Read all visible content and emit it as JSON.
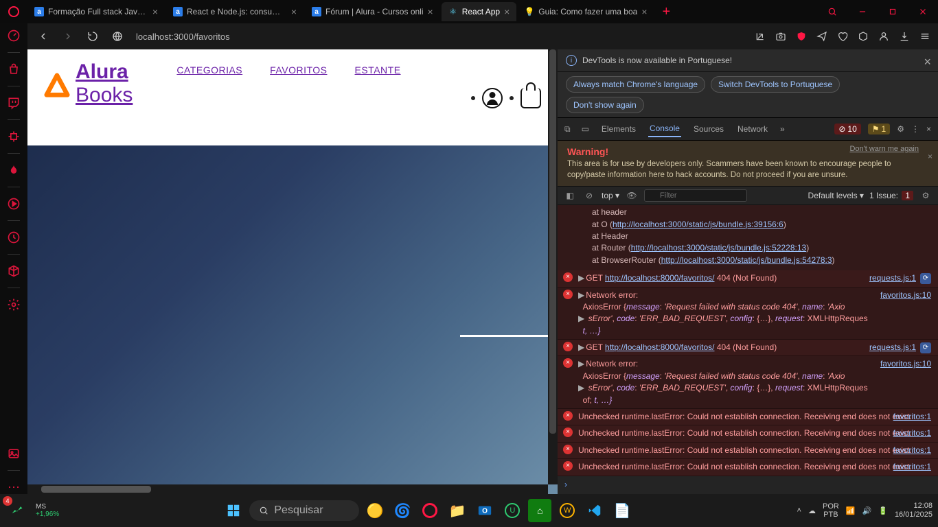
{
  "titlebar": {
    "tabs": [
      {
        "title": "Formação Full stack JavaSc",
        "icon": "a",
        "active": false
      },
      {
        "title": "React e Node.js: consumind",
        "icon": "a",
        "active": false
      },
      {
        "title": "Fórum | Alura - Cursos onli",
        "icon": "a",
        "active": false
      },
      {
        "title": "React App",
        "icon": "react",
        "active": true
      },
      {
        "title": "Guia: Como fazer uma boa",
        "icon": "bulb",
        "active": false
      }
    ]
  },
  "url": "localhost:3000/favoritos",
  "page": {
    "brand_top": "Alura",
    "brand_bottom": "Books",
    "nav": [
      "CATEGORIAS",
      "FAVORITOS",
      "ESTANTE"
    ]
  },
  "devtools": {
    "banner": "DevTools is now available in Portuguese!",
    "btns": [
      "Always match Chrome's language",
      "Switch DevTools to Portuguese",
      "Don't show again"
    ],
    "tabs": [
      "Elements",
      "Console",
      "Sources",
      "Network"
    ],
    "active_tab": "Console",
    "err_count": "10",
    "warn_count": "1",
    "warning_title": "Warning!",
    "warning_body": "This area is for use by developers only. Scammers have been known to encourage people to copy/paste information here to hack accounts. Do not proceed if you are unsure.",
    "warning_link": "Don't warn me again",
    "filter": {
      "top": "top",
      "placeholder": "Filter",
      "levels": "Default levels",
      "issues": "1 Issue:",
      "issues_n": "1"
    },
    "stack": [
      "at header",
      "at O (http://localhost:3000/static/js/bundle.js:39156:6)",
      "at Header",
      "at Router (http://localhost:3000/static/js/bundle.js:52228:13)",
      "at BrowserRouter (http://localhost:3000/static/js/bundle.js:54278:3)"
    ],
    "get_line": {
      "method": "GET",
      "url": "http://localhost:8000/favoritos/",
      "status": "404 (Not Found)",
      "src": "requests.js:1"
    },
    "netblock": {
      "title": "Network error:",
      "src": "favoritos.js:10",
      "l1a": "AxiosError {",
      "l1b": "message",
      "l1c": ": ",
      "l1d": "'Request failed with status code 404'",
      "l1e": ", ",
      "l1f": "name",
      "l1g": ": ",
      "l1h": "'Axio",
      "l2a": "sError'",
      "l2b": ", ",
      "l2c": "code",
      "l2d": ": ",
      "l2e": "'ERR_BAD_REQUEST'",
      "l2f": ", ",
      "l2g": "config",
      "l2h": ": {…}, ",
      "l2i": "request",
      "l2j": ": XMLHttpReques",
      "l3": "t, …}"
    },
    "runtime": {
      "msg": "Unchecked runtime.lastError: Could not establish connection. Receiving end does not exist.",
      "src": "favoritos:1"
    }
  },
  "taskbar": {
    "stock_name": "MS",
    "stock_pct": "+1,96%",
    "search": "Pesquisar",
    "lang1": "POR",
    "lang2": "PTB",
    "time": "12:08",
    "date": "16/01/2025"
  }
}
